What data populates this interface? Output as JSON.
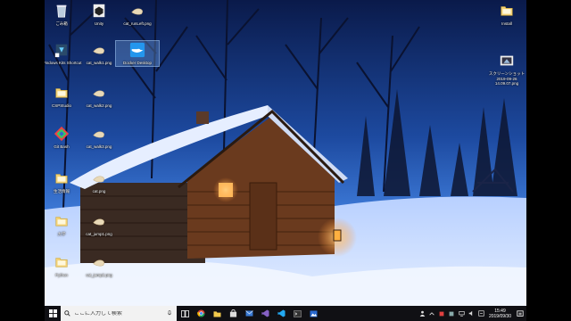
{
  "desktop": {
    "icons": [
      {
        "label": "ごみ箱",
        "icon": "recycle-bin-icon"
      },
      {
        "label": "Unity",
        "icon": "unity-icon"
      },
      {
        "label": "cat_runLeft.png",
        "icon": "image-file-icon"
      },
      {
        "label": "Windows Kits Shortcut",
        "icon": "shortcut-icon"
      },
      {
        "label": "cat_walk1.png",
        "icon": "image-file-icon"
      },
      {
        "label": "Docker Desktop",
        "icon": "docker-icon"
      },
      {
        "label": "CSPStudio",
        "icon": "folder-icon"
      },
      {
        "label": "cat_walk2.png",
        "icon": "image-file-icon"
      },
      {
        "label": "Git Bash",
        "icon": "git-bash-icon"
      },
      {
        "label": "cat_walk3.png",
        "icon": "image-file-icon"
      },
      {
        "label": "生活情報",
        "icon": "folder-icon"
      },
      {
        "label": "cat.png",
        "icon": "image-file-icon"
      },
      {
        "label": "大学",
        "icon": "folder-icon"
      },
      {
        "label": "cat_jump1.png",
        "icon": "image-file-icon"
      },
      {
        "label": "Python",
        "icon": "folder-icon"
      },
      {
        "label": "cat_jump2.png",
        "icon": "image-file-icon"
      },
      {
        "label": "Install",
        "icon": "folder-icon"
      },
      {
        "label": "スクリーンショット 2019-09-26 14.09.07.png",
        "icon": "screenshot-file-icon"
      }
    ]
  },
  "taskbar": {
    "search_placeholder": "ここに入力して検索",
    "pinned": [
      {
        "name": "task-view-icon"
      },
      {
        "name": "chrome-icon"
      },
      {
        "name": "file-explorer-icon"
      },
      {
        "name": "store-icon"
      },
      {
        "name": "mail-icon"
      },
      {
        "name": "visual-studio-icon"
      },
      {
        "name": "vscode-icon"
      },
      {
        "name": "terminal-icon"
      },
      {
        "name": "photos-icon"
      }
    ],
    "clock_time": "15:49",
    "clock_date": "2019/09/30"
  },
  "colors": {
    "sky_top": "#0a1a4a",
    "sky_mid": "#1f4ea8",
    "snow": "#c9dcff",
    "window_glow": "#ffb347",
    "taskbar": "#101014"
  }
}
